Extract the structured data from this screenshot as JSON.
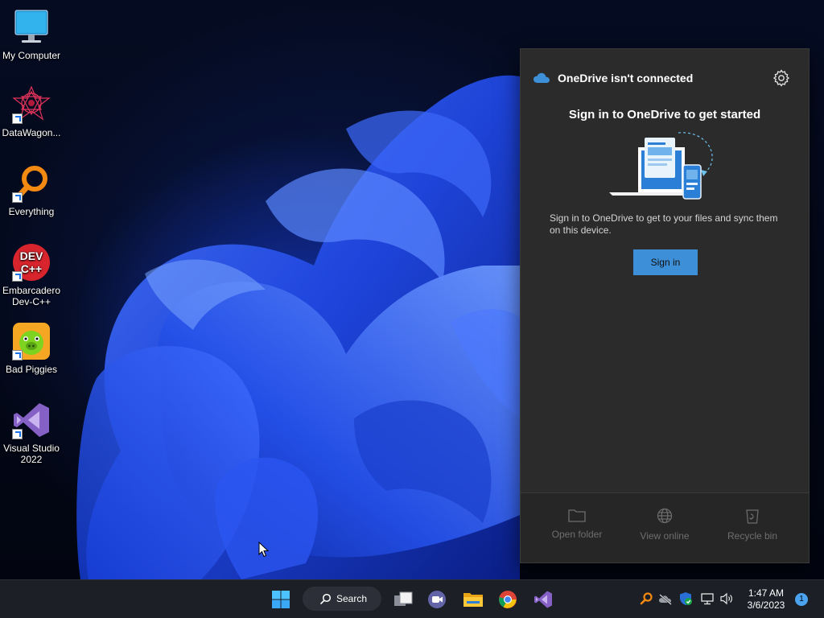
{
  "desktop": {
    "icons": [
      {
        "label": "My Computer",
        "icon": "monitor-icon"
      },
      {
        "label": "DataWagon...",
        "icon": "datawagon-icon"
      },
      {
        "label": "Everything",
        "icon": "everything-search-icon"
      },
      {
        "label": "Embarcadero Dev-C++",
        "icon": "devcpp-icon"
      },
      {
        "label": "Bad Piggies",
        "icon": "bad-piggies-icon"
      },
      {
        "label": "Visual Studio 2022",
        "icon": "visual-studio-icon"
      }
    ],
    "devcpp_badge_line1": "DEV",
    "devcpp_badge_line2": "C++"
  },
  "onedrive": {
    "title": "OneDrive isn't connected",
    "heading": "Sign in to OneDrive to get started",
    "description": "Sign in to OneDrive to get to your files and sync them on this device.",
    "signin_label": "Sign in",
    "footer": {
      "open_folder": "Open folder",
      "view_online": "View online",
      "recycle_bin": "Recycle bin"
    },
    "accent_color": "#3d8fd8"
  },
  "taskbar": {
    "search_label": "Search",
    "clock_time": "1:47 AM",
    "clock_date": "3/6/2023",
    "notification_count": "1"
  }
}
